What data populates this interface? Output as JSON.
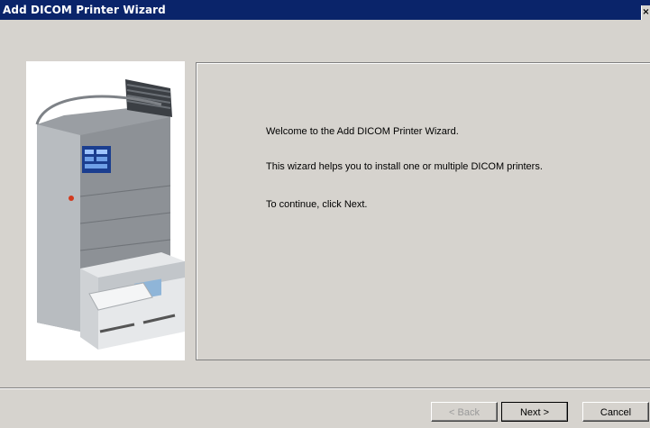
{
  "window": {
    "title": "Add DICOM Printer Wizard",
    "close_glyph": "×"
  },
  "welcome": {
    "heading": "Welcome to the Add DICOM Printer Wizard.",
    "description": "This wizard helps you to install one or multiple DICOM printers.",
    "instruction": "To continue, click Next."
  },
  "buttons": {
    "back": "< Back",
    "next": "Next >",
    "cancel": "Cancel"
  },
  "colors": {
    "titlebar": "#0a246a",
    "dialog_background": "#d6d3ce",
    "disabled_text": "#9a9a9a"
  },
  "icons": {
    "close": "close-icon",
    "printer_image": "dicom-printer-illustration"
  }
}
